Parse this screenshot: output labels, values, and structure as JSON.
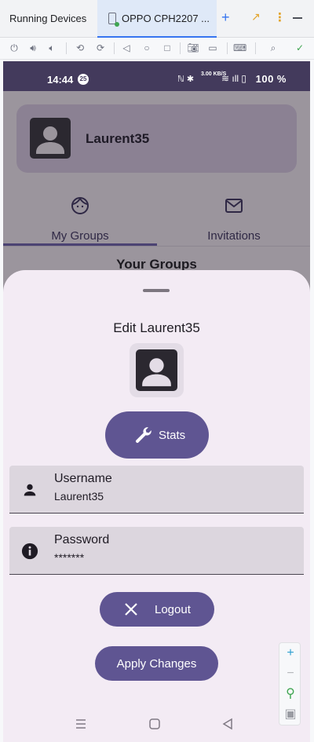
{
  "ide": {
    "title": "Running Devices",
    "device_tab": "OPPO CPH2207 ...",
    "add_label": "+",
    "more_label": "⋮"
  },
  "status_bar": {
    "time": "14:44",
    "badge": "25",
    "network_speed": "3.00 KB/S",
    "battery": "100 %"
  },
  "profile": {
    "username": "Laurent35"
  },
  "tabs": [
    {
      "label": "My Groups",
      "icon": "face-icon",
      "selected": true
    },
    {
      "label": "Invitations",
      "icon": "mail-icon",
      "selected": false
    }
  ],
  "groups_heading": "Your Groups",
  "sheet": {
    "title": "Edit Laurent35",
    "stats_label": "Stats",
    "username_label": "Username",
    "username_value": "Laurent35",
    "password_label": "Password",
    "password_value": "*******",
    "logout_label": "Logout",
    "apply_label": "Apply Changes"
  },
  "colors": {
    "accent": "#5f5592",
    "status_bar": "#433a5c",
    "sheet_bg": "#f3ebf4"
  }
}
